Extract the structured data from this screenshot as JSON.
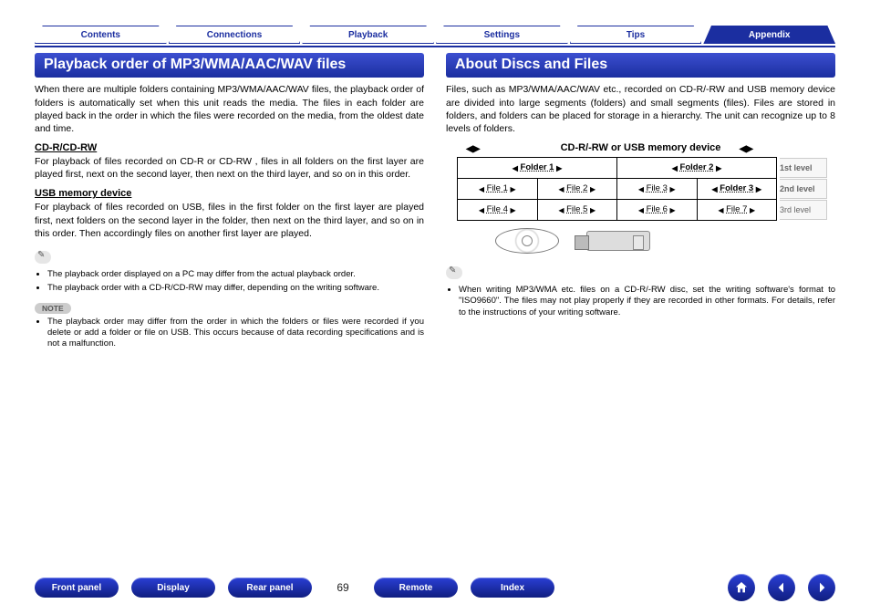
{
  "tabs": [
    {
      "label": "Contents",
      "active": false
    },
    {
      "label": "Connections",
      "active": false
    },
    {
      "label": "Playback",
      "active": false
    },
    {
      "label": "Settings",
      "active": false
    },
    {
      "label": "Tips",
      "active": false
    },
    {
      "label": "Appendix",
      "active": true
    }
  ],
  "left": {
    "heading": "Playback order of MP3/WMA/AAC/WAV files",
    "intro": "When there are multiple folders containing MP3/WMA/AAC/WAV files, the playback order of folders is automatically set when this unit reads the media. The files in each folder are played back in the order in which the files were recorded on the media, from the oldest date and time.",
    "sub1_title": "CD-R/CD-RW",
    "sub1_body": "For playback of files recorded on CD-R or CD-RW , files in all folders on the first layer are played first, next on the second layer, then next on the third layer, and so on in this order.",
    "sub2_title": "USB memory device",
    "sub2_body": "For playback of files recorded on USB, files in the first folder on the first layer are played first, next folders on the second layer in the folder, then next on the third layer, and so on in this order. Then accordingly files on another first layer are played.",
    "bullets1": [
      "The playback order displayed on a PC may differ from the actual playback order.",
      "The playback order with a CD-R/CD-RW may differ, depending on the writing software."
    ],
    "note_label": "NOTE",
    "bullets2": [
      "The playback order may differ from the order in which the folders or files were recorded if you delete or add a folder or file on USB. This occurs because of data recording specifications and is not a malfunction."
    ]
  },
  "right": {
    "heading": "About Discs and Files",
    "intro": "Files, such as MP3/WMA/AAC/WAV etc., recorded on CD-R/-RW and USB memory device are divided into large segments (folders) and small segments (files). Files are stored in folders, and folders can be placed for storage in a hierarchy. The unit can recognize up to 8 levels of folders.",
    "diagram": {
      "title": "CD-R/-RW or USB memory device",
      "levels": [
        "1st level",
        "2nd level",
        "3rd level"
      ],
      "row1": [
        "Folder 1",
        "Folder 2"
      ],
      "row2": [
        "File 1",
        "File 2",
        "File 3",
        "Folder 3"
      ],
      "row3": [
        "File 4",
        "File 5",
        "File 6",
        "File 7"
      ]
    },
    "bullets": [
      "When writing MP3/WMA etc. files on a CD-R/-RW disc, set the writing software's format to \"ISO9660\". The files may not play properly if they are recorded in other formats. For details, refer to the instructions of your writing software."
    ]
  },
  "footer": {
    "buttons_left": [
      "Front panel",
      "Display",
      "Rear panel"
    ],
    "page": "69",
    "buttons_right": [
      "Remote",
      "Index"
    ]
  }
}
